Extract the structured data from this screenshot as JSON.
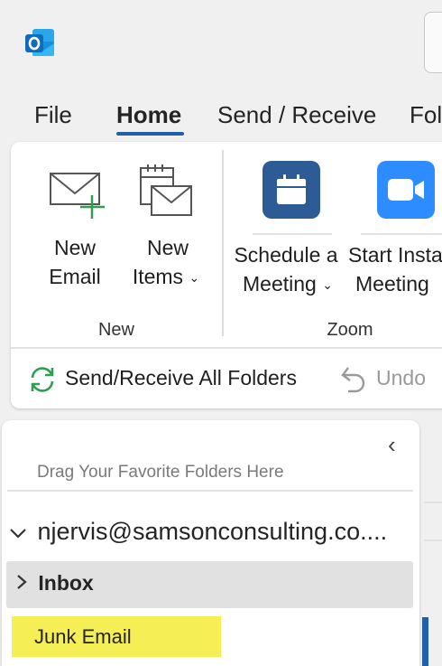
{
  "menu": {
    "tabs": [
      {
        "label": "File"
      },
      {
        "label": "Home"
      },
      {
        "label": "Send / Receive"
      },
      {
        "label": "Fol"
      }
    ],
    "active_tab": "Home"
  },
  "ribbon": {
    "new_group": {
      "new_email": {
        "line1": "New",
        "line2": "Email"
      },
      "new_items": {
        "line1": "New",
        "line2": "Items"
      },
      "group_label": "New"
    },
    "zoom_group": {
      "schedule_meeting": {
        "line1": "Schedule a",
        "line2": "Meeting"
      },
      "start_instant": {
        "line1": "Start Insta",
        "line2": "Meeting"
      },
      "group_label": "Zoom"
    },
    "quick_bar": {
      "send_receive_all": "Send/Receive All Folders",
      "undo": "Undo"
    }
  },
  "folder_pane": {
    "favorites_hint": "Drag Your Favorite Folders Here",
    "account": "njervis@samsonconsulting.co....",
    "folders": [
      {
        "label": "Inbox"
      },
      {
        "label": "Junk Email"
      }
    ]
  },
  "colors": {
    "accent": "#1f5fae",
    "outlook_blue": "#0f6cbd",
    "zoom_dark": "#2d5b96",
    "zoom_bright": "#2d8cff",
    "send_receive_green": "#2e9f4f",
    "highlight_yellow": "#f5ef55"
  },
  "icons": {
    "app": "outlook-logo-icon",
    "new_email": "envelope-plus-icon",
    "new_items": "calendar-envelope-icon",
    "schedule": "zoom-calendar-icon",
    "instant": "zoom-camera-icon",
    "sync": "sync-arrows-icon",
    "undo": "undo-icon"
  }
}
